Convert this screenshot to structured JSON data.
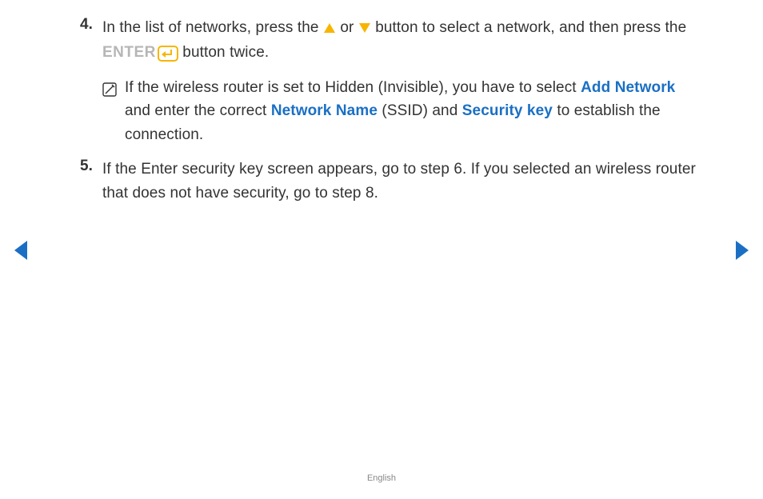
{
  "steps": {
    "s4": {
      "num": "4.",
      "text_a": "In the list of networks, press the ",
      "text_or": " or ",
      "text_b": " button to select a network, and then press the ",
      "enter_label": "ENTER",
      "text_c": " button twice."
    },
    "note": {
      "text_a": "If the wireless router is set to Hidden (Invisible), you have to select ",
      "link_add_network": "Add Network",
      "text_b": " and enter the correct ",
      "link_network_name": "Network Name",
      "ssid": " (SSID) and ",
      "link_security_key": "Security key",
      "text_c": " to establish the connection."
    },
    "s5": {
      "num": "5.",
      "text": "If the Enter security key screen appears, go to step 6. If you selected an wireless router that does not have security, go to step 8."
    }
  },
  "footer": {
    "language": "English"
  },
  "icons": {
    "up": "up-triangle-icon",
    "down": "down-triangle-icon",
    "enter": "enter-icon",
    "note": "note-icon",
    "prev": "prev-arrow-icon",
    "next": "next-arrow-icon"
  },
  "colors": {
    "accent_yellow": "#f7b500",
    "link_blue": "#1a6fc4",
    "nav_blue": "#1a6fc4",
    "muted_gray": "#b6b6b6"
  }
}
